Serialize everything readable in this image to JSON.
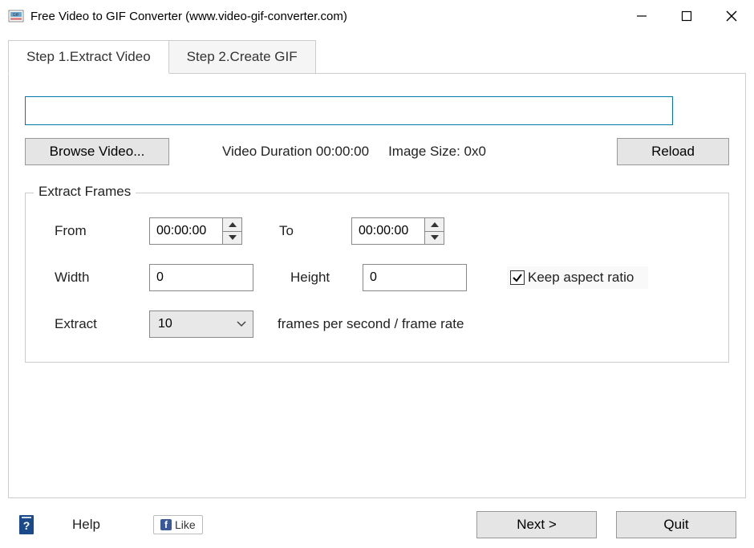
{
  "window": {
    "title": "Free Video to GIF Converter (www.video-gif-converter.com)"
  },
  "tabs": {
    "step1": "Step 1.Extract Video",
    "step2": "Step 2.Create GIF"
  },
  "main": {
    "path_value": "",
    "browse_label": "Browse Video...",
    "duration_label": "Video Duration 00:00:00",
    "image_size_label": "Image Size: 0x0",
    "reload_label": "Reload"
  },
  "extract": {
    "legend": "Extract Frames",
    "from_label": "From",
    "from_value": "00:00:00",
    "to_label": "To",
    "to_value": "00:00:00",
    "width_label": "Width",
    "width_value": "0",
    "height_label": "Height",
    "height_value": "0",
    "keep_ratio_label": "Keep aspect ratio",
    "keep_ratio_checked": true,
    "extract_label": "Extract",
    "fps_value": "10",
    "fps_suffix": "frames per second / frame rate"
  },
  "footer": {
    "help_label": "Help",
    "like_label": "Like",
    "next_label": "Next >",
    "quit_label": "Quit"
  }
}
